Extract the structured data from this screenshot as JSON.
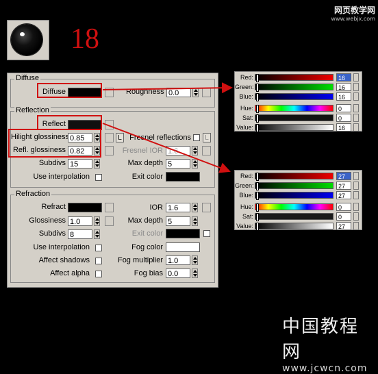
{
  "header": {
    "step_number": "18",
    "watermark_top_line1": "网页教学网",
    "watermark_top_line2": "www.webjx.com"
  },
  "diffuse": {
    "title": "Diffuse",
    "diffuse_label": "Diffuse",
    "diffuse_color": "#000000",
    "roughness_label": "Roughness",
    "roughness_value": "0.0"
  },
  "reflection": {
    "title": "Reflection",
    "reflect_label": "Reflect",
    "reflect_color": "#101010",
    "hilight_label": "Hilight glossiness",
    "hilight_value": "0.85",
    "l_button": "L",
    "fresnel_label": "Fresnel reflections",
    "fresnel_l": "L",
    "refl_gloss_label": "Refl. glossiness",
    "refl_gloss_value": "0.82",
    "fresnel_ior_label": "Fresnel IOR",
    "fresnel_ior_value": "1.6",
    "subdivs_label": "Subdivs",
    "subdivs_value": "15",
    "max_depth_label": "Max depth",
    "max_depth_value": "5",
    "use_interp_label": "Use interpolation",
    "exit_color_label": "Exit color",
    "exit_color": "#000000"
  },
  "refraction": {
    "title": "Refraction",
    "refract_label": "Refract",
    "refract_color": "#000000",
    "ior_label": "IOR",
    "ior_value": "1.6",
    "glossiness_label": "Glossiness",
    "glossiness_value": "1.0",
    "max_depth_label": "Max depth",
    "max_depth_value": "5",
    "subdivs_label": "Subdivs",
    "subdivs_value": "8",
    "exit_color_label": "Exit color",
    "exit_color": "#000000",
    "use_interp_label": "Use interpolation",
    "fog_color_label": "Fog color",
    "fog_color": "#ffffff",
    "affect_shadows_label": "Affect shadows",
    "fog_mult_label": "Fog multiplier",
    "fog_mult_value": "1.0",
    "affect_alpha_label": "Affect alpha",
    "fog_bias_label": "Fog bias",
    "fog_bias_value": "0.0"
  },
  "picker1": {
    "red_label": "Red:",
    "red_value": "16",
    "green_label": "Green:",
    "green_value": "16",
    "blue_label": "Blue:",
    "blue_value": "16",
    "hue_label": "Hue:",
    "hue_value": "0",
    "sat_label": "Sat:",
    "sat_value": "0",
    "value_label": "Value:",
    "value_value": "16"
  },
  "picker2": {
    "red_label": "Red:",
    "red_value": "27",
    "green_label": "Green:",
    "green_value": "27",
    "blue_label": "Blue:",
    "blue_value": "27",
    "hue_label": "Hue:",
    "hue_value": "0",
    "sat_label": "Sat:",
    "sat_value": "0",
    "value_label": "Value:",
    "value_value": "27"
  },
  "watermark_bottom": {
    "cn": "中国教程网",
    "url": "www.jcwcn.com"
  }
}
